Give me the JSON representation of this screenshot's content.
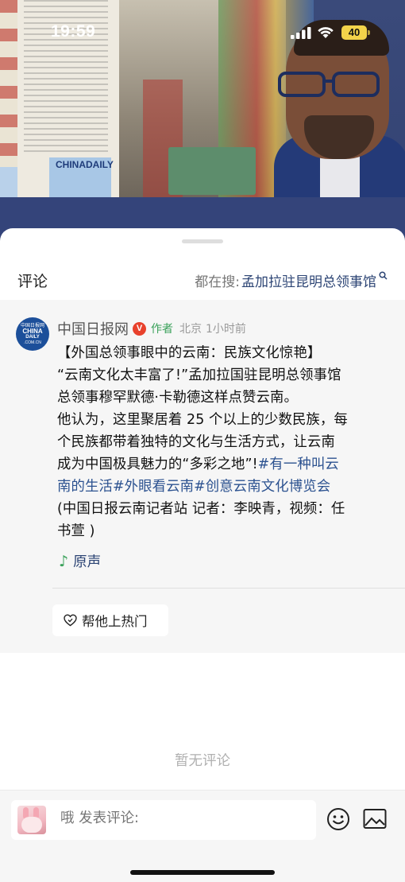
{
  "status_bar": {
    "time": "19:59",
    "battery": "40",
    "battery_color": "#f3d34a"
  },
  "video": {
    "poster_brand": "CHINADAILY"
  },
  "comments": {
    "title": "评论",
    "search_prefix": "都在搜:",
    "search_term": "孟加拉驻昆明总领事馆",
    "search_icon": "search-icon",
    "post": {
      "avatar_lines": [
        "中国日报网",
        "CHINA",
        "DAILY",
        ".COM.CN"
      ],
      "author": "中国日报网",
      "verified": "V",
      "author_tag": "作者",
      "location": "北京",
      "time_ago": "1小时前",
      "lines": [
        "【外国总领事眼中的云南：民族文化惊艳】",
        "“云南文化太丰富了!”孟加拉国驻昆明总领事馆",
        "总领事穆罕默德·卡勒德这样点赞云南。",
        "他认为，这里聚居着 25 个以上的少数民族，每",
        "个民族都带着独特的文化与生活方式，让云南",
        "成为中国极具魅力的“多彩之地”!"
      ],
      "hashtag_1_part1": "#有一种叫云",
      "hashtag_1_part2": "南的生活",
      "hashtag_2": "#外眼看云南",
      "hashtag_3": "#创意云南文化博览会",
      "credit_line_1": "(中国日报云南记者站 记者：李映青，视频：任",
      "credit_line_2": "书萱 )",
      "audio_label": "原声",
      "audio_icon": "music-note-icon",
      "boost_label": "帮他上热门",
      "boost_icon": "heart-icon",
      "accent_color": "#2c5290",
      "tag_color": "#3aa15a"
    },
    "empty_text": "暂无评论",
    "input": {
      "placeholder": "哦 发表评论:"
    }
  }
}
